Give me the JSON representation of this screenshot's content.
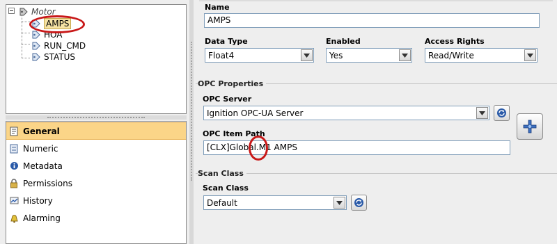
{
  "tree": {
    "root_label": "Motor",
    "items": [
      {
        "label": "AMPS"
      },
      {
        "label": "HOA"
      },
      {
        "label": "RUN_CMD"
      },
      {
        "label": "STATUS"
      }
    ]
  },
  "categories": [
    {
      "label": "General",
      "icon": "general-icon"
    },
    {
      "label": "Numeric",
      "icon": "numeric-icon"
    },
    {
      "label": "Metadata",
      "icon": "metadata-icon"
    },
    {
      "label": "Permissions",
      "icon": "lock-icon"
    },
    {
      "label": "History",
      "icon": "history-icon"
    },
    {
      "label": "Alarming",
      "icon": "bell-icon"
    }
  ],
  "form": {
    "name_label": "Name",
    "name_value": "AMPS",
    "data_type_label": "Data Type",
    "data_type_value": "Float4",
    "enabled_label": "Enabled",
    "enabled_value": "Yes",
    "access_label": "Access Rights",
    "access_value": "Read/Write"
  },
  "opc": {
    "section_title": "OPC Properties",
    "server_label": "OPC Server",
    "server_value": "Ignition OPC-UA Server",
    "item_path_label": "OPC Item Path",
    "item_path_value": "[CLX]Global.M1 AMPS"
  },
  "scan": {
    "section_title": "Scan Class",
    "label": "Scan Class",
    "value": "Default"
  },
  "colors": {
    "selection": "#fbd588",
    "annotation": "#c81818",
    "accent": "#2a5aa8"
  }
}
